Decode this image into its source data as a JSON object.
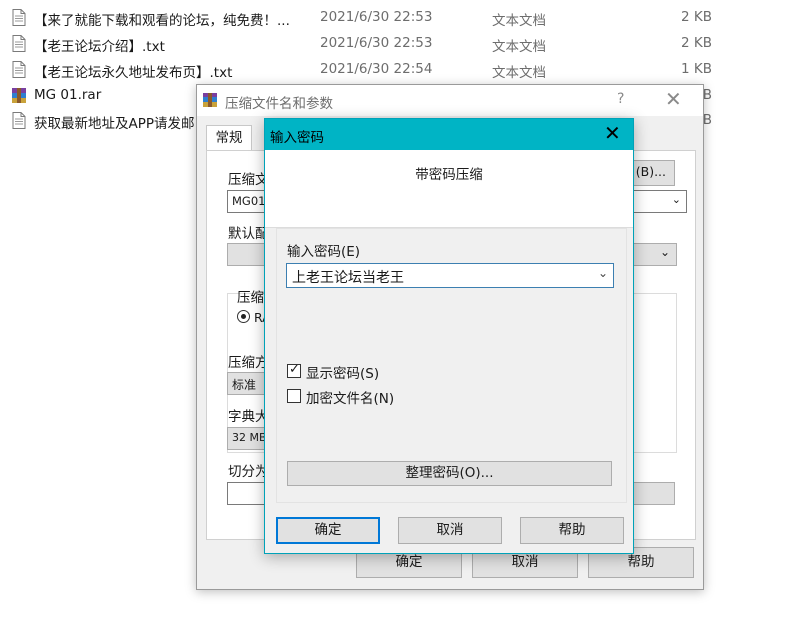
{
  "explorer": {
    "files": [
      {
        "name": "【来了就能下载和观看的论坛，纯免费！...",
        "date": "2021/6/30 22:53",
        "type": "文本文档",
        "size": "2 KB",
        "icon": "text-file-icon"
      },
      {
        "name": "【老王论坛介绍】.txt",
        "date": "2021/6/30 22:53",
        "type": "文本文档",
        "size": "2 KB",
        "icon": "text-file-icon"
      },
      {
        "name": "【老王论坛永久地址发布页】.txt",
        "date": "2021/6/30 22:54",
        "type": "文本文档",
        "size": "1 KB",
        "icon": "text-file-icon"
      },
      {
        "name": "MG 01.rar",
        "date": "",
        "type": "",
        "size": "KB",
        "icon": "rar-archive-icon"
      },
      {
        "name": "获取最新地址及APP请发邮",
        "date": "",
        "type": "",
        "size": "KB",
        "icon": "text-file-icon"
      }
    ]
  },
  "archive_dialog": {
    "title": "压缩文件名和参数",
    "help": "?",
    "close": "✕",
    "tab_general": "常规",
    "label_archive_name": "压缩文",
    "archive_name_value": "MG01.",
    "browse_button": "(B)...",
    "label_default": "默认配",
    "label_format": "压缩",
    "format_radio": "RA",
    "label_method": "压缩方",
    "method_value": "标准",
    "label_dict": "字典大",
    "dict_value": "32 MB",
    "label_split": "切分为",
    "right_edge_mark": ")",
    "ok": "确定",
    "cancel": "取消",
    "help_button": "帮助"
  },
  "password_dialog": {
    "title": "输入密码",
    "close": "✕",
    "subtitle": "带密码压缩",
    "label_password": "输入密码(E)",
    "password_value": "上老王论坛当老王",
    "show_password_label": "显示密码(S)",
    "show_password_checked": "✓",
    "encrypt_names_label": "加密文件名(N)",
    "organize_button": "整理密码(O)...",
    "ok": "确定",
    "cancel": "取消",
    "help": "帮助"
  },
  "colors": {
    "accent_titlebar": "#00b4c5",
    "default_button_border": "#0078d7"
  }
}
